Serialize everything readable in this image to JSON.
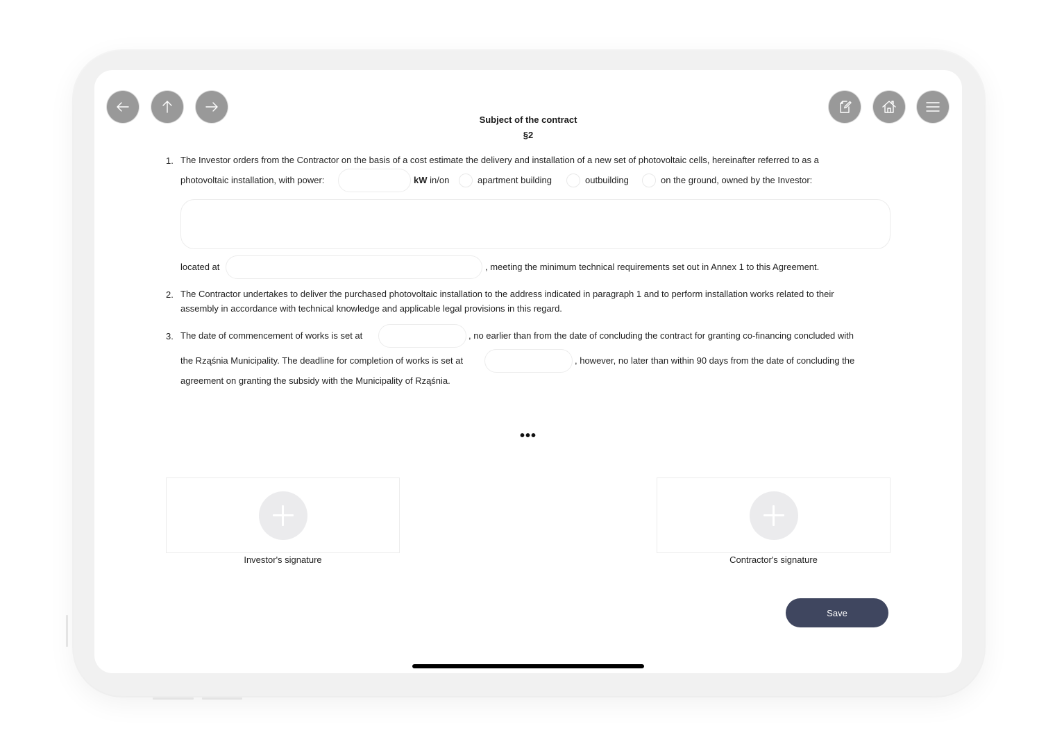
{
  "nav": {
    "back_icon": "arrow-left-icon",
    "up_icon": "arrow-up-icon",
    "forward_icon": "arrow-right-icon",
    "edit_icon": "edit-document-icon",
    "home_icon": "home-icon",
    "menu_icon": "hamburger-menu-icon"
  },
  "header": {
    "title": "Subject of the contract",
    "section": "§2"
  },
  "clause1": {
    "number": "1.",
    "line1": "The Investor orders from the Contractor on the basis of a cost estimate the delivery and installation of a new set of photovoltaic cells, hereinafter referred to as a",
    "line2_prefix": "photovoltaic installation, with power:",
    "power_value": "",
    "unit": "kW",
    "in_on": "in/on",
    "options": [
      "apartment building",
      "outbuilding",
      "on the ground"
    ],
    "owned_suffix": ", owned by the Investor:",
    "description_value": "",
    "located_at_label": "located at",
    "location_value": "",
    "requirements_suffix": ", meeting the minimum technical requirements set out in Annex 1 to this Agreement."
  },
  "clause2": {
    "number": "2.",
    "line1": "The Contractor undertakes to deliver the purchased photovoltaic installation to the address indicated in paragraph 1 and to perform installation works related to their",
    "line2": "assembly in accordance with technical knowledge and applicable legal provisions in this regard."
  },
  "clause3": {
    "number": "3.",
    "line1_prefix": "The date of commencement of works is set at",
    "start_date_value": "",
    "line1_suffix": ", no earlier than from the date of concluding the contract for granting co-financing concluded with",
    "line2_prefix": "the Rząśnia Municipality. The deadline for completion of works is set at",
    "end_date_value": "",
    "line2_suffix": ", however, no later than within 90 days from the date of concluding the",
    "line3": "agreement on granting the subsidy with the Municipality of Rząśnia."
  },
  "ellipsis": "•••",
  "signatures": {
    "investor_label": "Investor's signature",
    "contractor_label": "Contractor's signature",
    "add_icon": "plus-icon"
  },
  "actions": {
    "save_label": "Save"
  },
  "colors": {
    "nav_button": "#999999",
    "save_button": "#3f465f",
    "signature_add": "#ebebed"
  }
}
